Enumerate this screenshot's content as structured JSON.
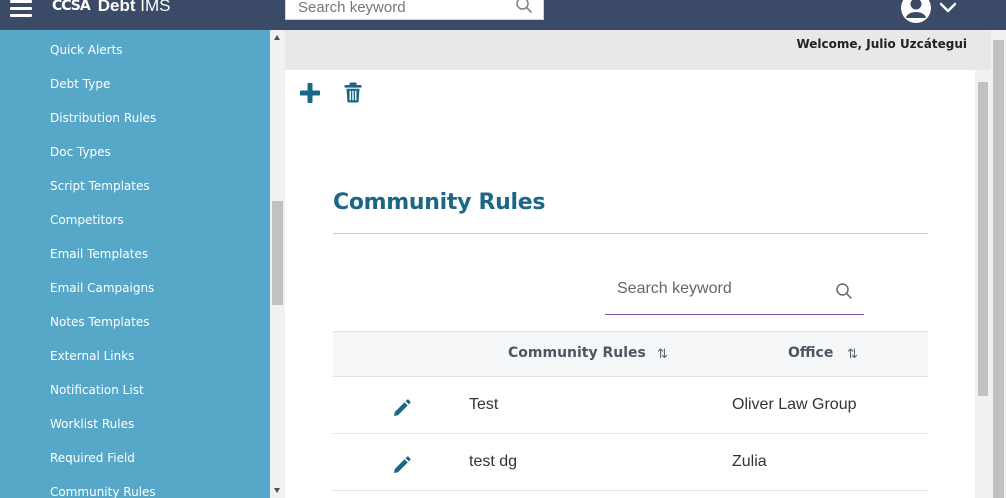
{
  "app": {
    "logo_mark": "CCSA",
    "logo_bold": "Debt",
    "logo_rest": " IMS",
    "search_placeholder": "Search keyword"
  },
  "sidebar": {
    "items": [
      {
        "label": "Quick Alerts"
      },
      {
        "label": "Debt Type"
      },
      {
        "label": "Distribution Rules"
      },
      {
        "label": "Doc Types"
      },
      {
        "label": "Script Templates"
      },
      {
        "label": "Competitors"
      },
      {
        "label": "Email Templates"
      },
      {
        "label": "Email Campaigns"
      },
      {
        "label": "Notes Templates"
      },
      {
        "label": "External Links"
      },
      {
        "label": "Notification List"
      },
      {
        "label": "Worklist Rules"
      },
      {
        "label": "Required Field"
      },
      {
        "label": "Community Rules"
      }
    ]
  },
  "header": {
    "welcome": "Welcome, Julio Uzcátegui"
  },
  "page": {
    "title": "Community Rules",
    "search_placeholder": "Search keyword"
  },
  "table": {
    "columns": [
      {
        "label": "Community Rules",
        "sort_icon": "⇅"
      },
      {
        "label": "Office",
        "sort_icon": "⇅"
      }
    ],
    "rows": [
      {
        "rule": "Test",
        "office": "Oliver Law Group"
      },
      {
        "rule": "test dg",
        "office": "Zulia"
      }
    ]
  },
  "colors": {
    "topbar": "#3b4a66",
    "sidebar": "#57a8c8",
    "accent": "#1c6786",
    "search_underline": "#7a4ea8"
  }
}
